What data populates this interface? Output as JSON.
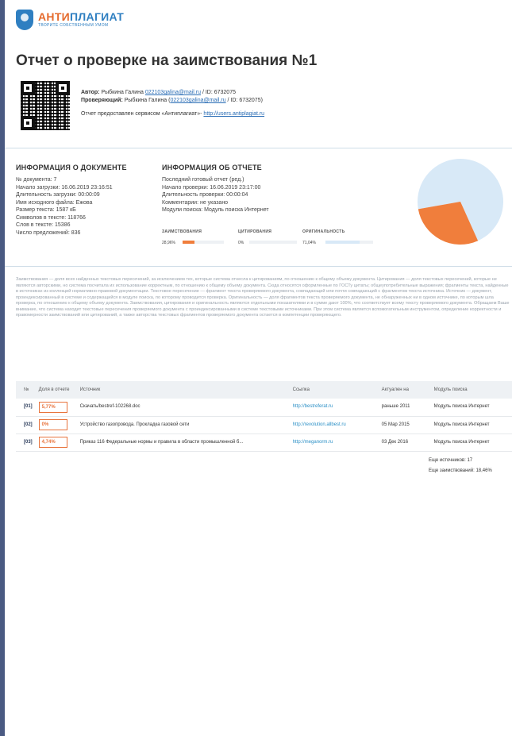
{
  "brand": {
    "name_orange": "АНТИ",
    "name_blue": "ПЛАГИАТ",
    "tagline": "ТВОРИТЕ СОБСТВЕННЫМ УМОМ"
  },
  "title": "Отчет о проверке на заимствования №1",
  "meta": {
    "author_label": "Автор:",
    "author_value": "Рыбкина Галина",
    "author_email": "022103galina@mail.ru",
    "author_id": " / ID: 6732075",
    "checker_label": "Проверяющий:",
    "checker_value": "Рыбкина Галина (",
    "checker_email": "022103galina@mail.ru",
    "checker_id": " / ID: 6732075)",
    "service_text": "Отчет предоставлен сервисом «Антиплагиат»-",
    "service_url": "http://users.antiplagiat.ru"
  },
  "doc_info": {
    "heading": "ИНФОРМАЦИЯ О ДОКУМЕНТЕ",
    "lines": [
      "№ документа: 7",
      "Начало загрузки: 16.06.2019 23:16:51",
      "Длительность загрузки: 00:00:09",
      "Имя исходного файла: Ежова",
      "Размер текста: 1587 кБ",
      "Символов в тексте: 118766",
      "Слов в тексте: 15386",
      "Число предложений: 836"
    ]
  },
  "report_info": {
    "heading": "ИНФОРМАЦИЯ ОБ ОТЧЕТЕ",
    "lines": [
      "Последний готовый отчет (ред.)",
      "Начало проверки: 16.06.2019 23:17:00",
      "Длительность проверки: 00:00:04",
      "Комментарии: не указано",
      "Модули поиска: Модуль поиска Интернет"
    ]
  },
  "metrics": {
    "borrowing_label": "ЗАИМСТВОВАНИЯ",
    "borrowing_value": "28,96%",
    "borrowing_pct": 28.96,
    "citation_label": "ЦИТИРОВАНИЯ",
    "citation_value": "0%",
    "citation_pct": 0,
    "originality_label": "ОРИГИНАЛЬНОСТЬ",
    "originality_value": "71,04%",
    "originality_pct": 71.04,
    "colors": {
      "borrowing": "#f07e3c",
      "originality": "#d8e9f7",
      "citation": "#8fc26a"
    }
  },
  "legend_text": "Заимствования — доля всех найденных текстовых пересечений, за исключением тех, которые система отнесла к цитированиям, по отношению к общему объему документа. Цитирования — доля текстовых пересечений, которые не являются авторскими, но система посчитала их использование корректным, по отношению к общему объему документа. Сюда относятся оформленные по ГОСТу цитаты; общеупотребительные выражения; фрагменты текста, найденные в источниках из коллекций нормативно-правовой документации. Текстовое пересечение — фрагмент текста проверяемого документа, совпадающий или почти совпадающий с фрагментом текста источника. Источник — документ, проиндексированный в системе и содержащийся в модуле поиска, по которому проводится проверка. Оригинальность — доля фрагментов текста проверяемого документа, не обнаруженных ни в одном источнике, по которым шла проверка, по отношению к общему объему документа. Заимствования, цитирования и оригинальность являются отдельными показателями и в сумме дают 100%, что соответствует всему тексту проверяемого документа. Обращаем Ваше внимание, что система находит текстовые пересечения проверяемого документа с проиндексированными в системе текстовыми источниками. При этом система является вспомогательным инструментом, определение корректности и правомерности заимствований или цитирований, а также авторства текстовых фрагментов проверяемого документа остается в компетенции проверяющего.",
  "table": {
    "headers": {
      "num": "№",
      "share": "Доля в отчете",
      "source": "Источник",
      "link": "Ссылка",
      "actual": "Актуален на",
      "module": "Модуль поиска"
    },
    "rows": [
      {
        "num": "[01]",
        "share": "5,77%",
        "source": "Скачать/bestref-102268.doc",
        "link": "http://bestreferat.ru",
        "actual": "раньше 2011",
        "module": "Модуль поиска Интернет"
      },
      {
        "num": "[02]",
        "share": "0%",
        "source": "Устройство газопровода. Прокладка газовой сети",
        "link": "http://revolution.allbest.ru",
        "actual": "05 Мар 2015",
        "module": "Модуль поиска Интернет"
      },
      {
        "num": "[03]",
        "share": "4,74%",
        "source": "Приказ 116 Федеральные нормы и правила в области промышленной б...",
        "link": "http://meganorm.ru",
        "actual": "03 Дек 2016",
        "module": "Модуль поиска Интернет"
      }
    ]
  },
  "extra": {
    "sources": "Еще источников: 17",
    "borrowings": "Еще заимствований: 18,46%"
  }
}
